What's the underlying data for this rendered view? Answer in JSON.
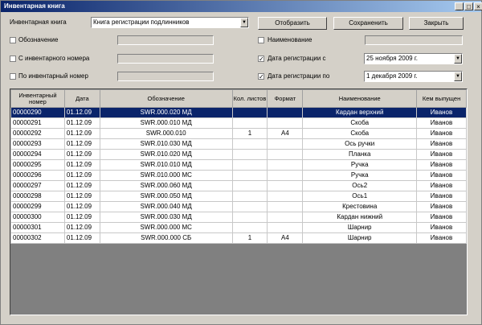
{
  "window": {
    "title": "Инвентарная книга"
  },
  "filters": {
    "book_label": "Инвентарная книга",
    "book_value": "Книга регистрации подлинников",
    "designation_label": "Обозначение",
    "from_inv_label": "С инвентарного номера",
    "to_inv_label": "По инвентарный номер",
    "name_label": "Наименование",
    "date_from_label": "Дата регистрации с",
    "date_from_value": "25  ноября  2009 г.",
    "date_to_label": "Дата регистрации по",
    "date_to_value": "1 декабря  2009 г."
  },
  "buttons": {
    "display": "Отобразить",
    "save": "Сохраненить",
    "close": "Закрыть"
  },
  "table": {
    "headers": [
      "Инвентарный номер",
      "Дата",
      "Обозначение",
      "Кол. листов",
      "Формат",
      "Наименование",
      "Кем выпущен"
    ],
    "rows": [
      [
        "00000290",
        "01.12.09",
        "SWR.000.020 МД",
        "",
        "",
        "Кардан верхний",
        "Иванов"
      ],
      [
        "00000291",
        "01.12.09",
        "SWR.000.010 МД",
        "",
        "",
        "Скоба",
        "Иванов"
      ],
      [
        "00000292",
        "01.12.09",
        "SWR.000.010",
        "1",
        "A4",
        "Скоба",
        "Иванов"
      ],
      [
        "00000293",
        "01.12.09",
        "SWR.010.030 МД",
        "",
        "",
        "Ось ручки",
        "Иванов"
      ],
      [
        "00000294",
        "01.12.09",
        "SWR.010.020 МД",
        "",
        "",
        "Планка",
        "Иванов"
      ],
      [
        "00000295",
        "01.12.09",
        "SWR.010.010 МД",
        "",
        "",
        "Ручка",
        "Иванов"
      ],
      [
        "00000296",
        "01.12.09",
        "SWR.010.000 МС",
        "",
        "",
        "Ручка",
        "Иванов"
      ],
      [
        "00000297",
        "01.12.09",
        "SWR.000.060 МД",
        "",
        "",
        "Ось2",
        "Иванов"
      ],
      [
        "00000298",
        "01.12.09",
        "SWR.000.050 МД",
        "",
        "",
        "Ось1",
        "Иванов"
      ],
      [
        "00000299",
        "01.12.09",
        "SWR.000.040 МД",
        "",
        "",
        "Крестовина",
        "Иванов"
      ],
      [
        "00000300",
        "01.12.09",
        "SWR.000.030 МД",
        "",
        "",
        "Кардан нижний",
        "Иванов"
      ],
      [
        "00000301",
        "01.12.09",
        "SWR.000.000 МС",
        "",
        "",
        "Шарнир",
        "Иванов"
      ],
      [
        "00000302",
        "01.12.09",
        "SWR.000.000 СБ",
        "1",
        "A4",
        "Шарнир",
        "Иванов"
      ]
    ],
    "selected_row": 0
  },
  "colors": {
    "titlebar": "#0a246a",
    "selection": "#0a246a",
    "window_bg": "#d4d0c8"
  }
}
